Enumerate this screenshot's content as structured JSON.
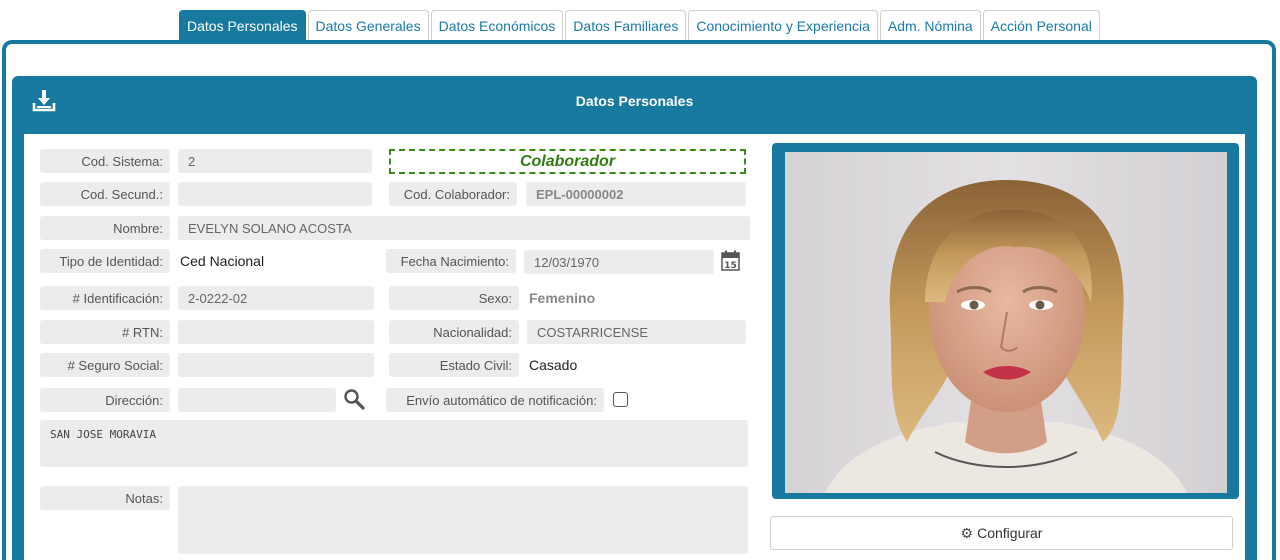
{
  "tabs": [
    {
      "label": "Datos Personales",
      "active": true
    },
    {
      "label": "Datos Generales"
    },
    {
      "label": "Datos Económicos"
    },
    {
      "label": "Datos Familiares"
    },
    {
      "label": "Conocimiento y Experiencia"
    },
    {
      "label": "Adm. Nómina"
    },
    {
      "label": "Acción Personal"
    }
  ],
  "panel": {
    "title": "Datos Personales",
    "download_icon": "download-tray-icon"
  },
  "form": {
    "cod_sistema": {
      "label": "Cod. Sistema:",
      "value": "2"
    },
    "badge": "Colaborador",
    "cod_secund": {
      "label": "Cod. Secund.:",
      "value": ""
    },
    "cod_colaborador": {
      "label": "Cod. Colaborador:",
      "value": "EPL-00000002"
    },
    "nombre": {
      "label": "Nombre:",
      "value": "EVELYN SOLANO ACOSTA"
    },
    "tipo_identidad": {
      "label": "Tipo de Identidad:",
      "value": "Ced Nacional"
    },
    "fecha_nacimiento": {
      "label": "Fecha Nacimiento:",
      "value": "12/03/1970",
      "icon": "calendar-icon"
    },
    "identificacion": {
      "label": "# Identificación:",
      "value": "2-0222-02"
    },
    "sexo": {
      "label": "Sexo:",
      "value": "Femenino"
    },
    "rtn": {
      "label": "# RTN:",
      "value": ""
    },
    "nacionalidad": {
      "label": "Nacionalidad:",
      "value": "COSTARRICENSE"
    },
    "seguro_social": {
      "label": "# Seguro Social:",
      "value": ""
    },
    "estado_civil": {
      "label": "Estado Civil:",
      "value": "Casado"
    },
    "direccion": {
      "label": "Dirección:",
      "value": "",
      "icon": "search-icon"
    },
    "envio": {
      "label": "Envío automático de notificación:",
      "checked": false
    },
    "direccion_texto": "SAN JOSE MORAVIA",
    "notas": {
      "label": "Notas:",
      "value": ""
    }
  },
  "photo": {
    "icon": "profile-photo"
  },
  "configurar": {
    "label": "Configurar",
    "icon": "gear-icon"
  },
  "colors": {
    "primary": "#17799e",
    "field_bg": "#eaeced",
    "badge": "#2f7d12"
  }
}
